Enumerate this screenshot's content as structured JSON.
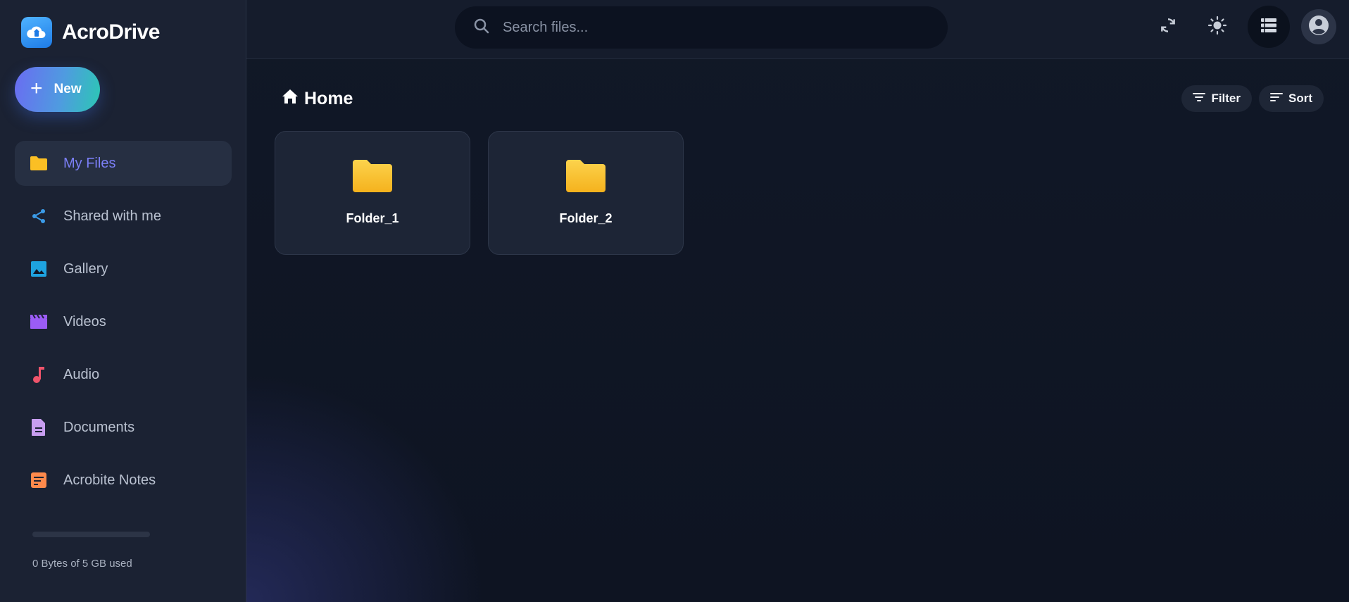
{
  "app": {
    "name": "AcroDrive"
  },
  "sidebar": {
    "new_label": "New",
    "items": [
      {
        "label": "My Files",
        "icon": "folder-icon",
        "active": true
      },
      {
        "label": "Shared with me",
        "icon": "share-icon",
        "active": false
      },
      {
        "label": "Gallery",
        "icon": "image-icon",
        "active": false
      },
      {
        "label": "Videos",
        "icon": "clapperboard-icon",
        "active": false
      },
      {
        "label": "Audio",
        "icon": "music-note-icon",
        "active": false
      },
      {
        "label": "Documents",
        "icon": "document-icon",
        "active": false
      },
      {
        "label": "Acrobite Notes",
        "icon": "note-icon",
        "active": false
      }
    ],
    "storage": {
      "text": "0 Bytes of 5 GB used",
      "used_fraction": 0
    }
  },
  "header": {
    "search_placeholder": "Search files...",
    "icons": [
      "sync-icon",
      "sun-icon",
      "list-view-icon",
      "account-circle-icon"
    ]
  },
  "content": {
    "title": "Home",
    "filter_label": "Filter",
    "sort_label": "Sort",
    "folders": [
      {
        "name": "Folder_1"
      },
      {
        "name": "Folder_2"
      }
    ]
  },
  "colors": {
    "accent": "#7b7ff6",
    "folder": "#fbbf24",
    "share": "#3b9be8",
    "gallery": "#1ea3e0",
    "videos": "#9b5cf6",
    "audio": "#f0546b",
    "documents": "#c89ef0",
    "notes": "#ff8a4c"
  }
}
